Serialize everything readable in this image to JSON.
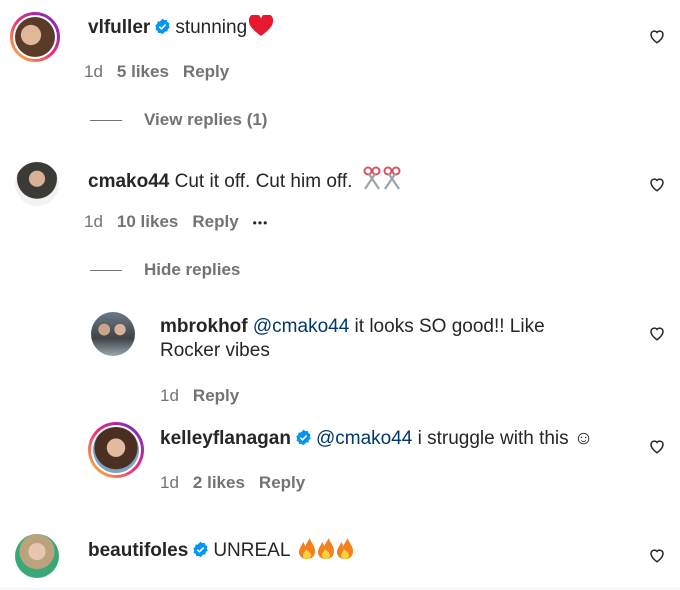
{
  "comments": [
    {
      "username": "vlfuller",
      "verified": true,
      "text": "stunning",
      "emoji": "red-heart",
      "time": "1d",
      "likes": "5 likes",
      "reply": "Reply",
      "replies_toggle": "View replies (1)"
    },
    {
      "username": "cmako44",
      "verified": false,
      "text": "Cut it off. Cut him off.",
      "emoji": "scissors",
      "time": "1d",
      "likes": "10 likes",
      "reply": "Reply",
      "more": "•••",
      "replies_toggle": "Hide replies",
      "replies": [
        {
          "username": "mbrokhof",
          "verified": false,
          "mention": "@cmako44",
          "text": " it looks SO good!! Like",
          "text_line2": "Rocker vibes",
          "time": "1d",
          "reply": "Reply"
        },
        {
          "username": "kelleyflanagan",
          "verified": true,
          "mention": "@cmako44",
          "text": " i struggle with this ☺",
          "time": "1d",
          "likes": "2 likes",
          "reply": "Reply"
        }
      ]
    },
    {
      "username": "beautifoles",
      "verified": true,
      "text": "UNREAL",
      "emoji": "fire x3"
    }
  ],
  "colors": {
    "text": "#262626",
    "meta": "#737373",
    "verified": "#0095f6",
    "mention": "#00376b"
  }
}
